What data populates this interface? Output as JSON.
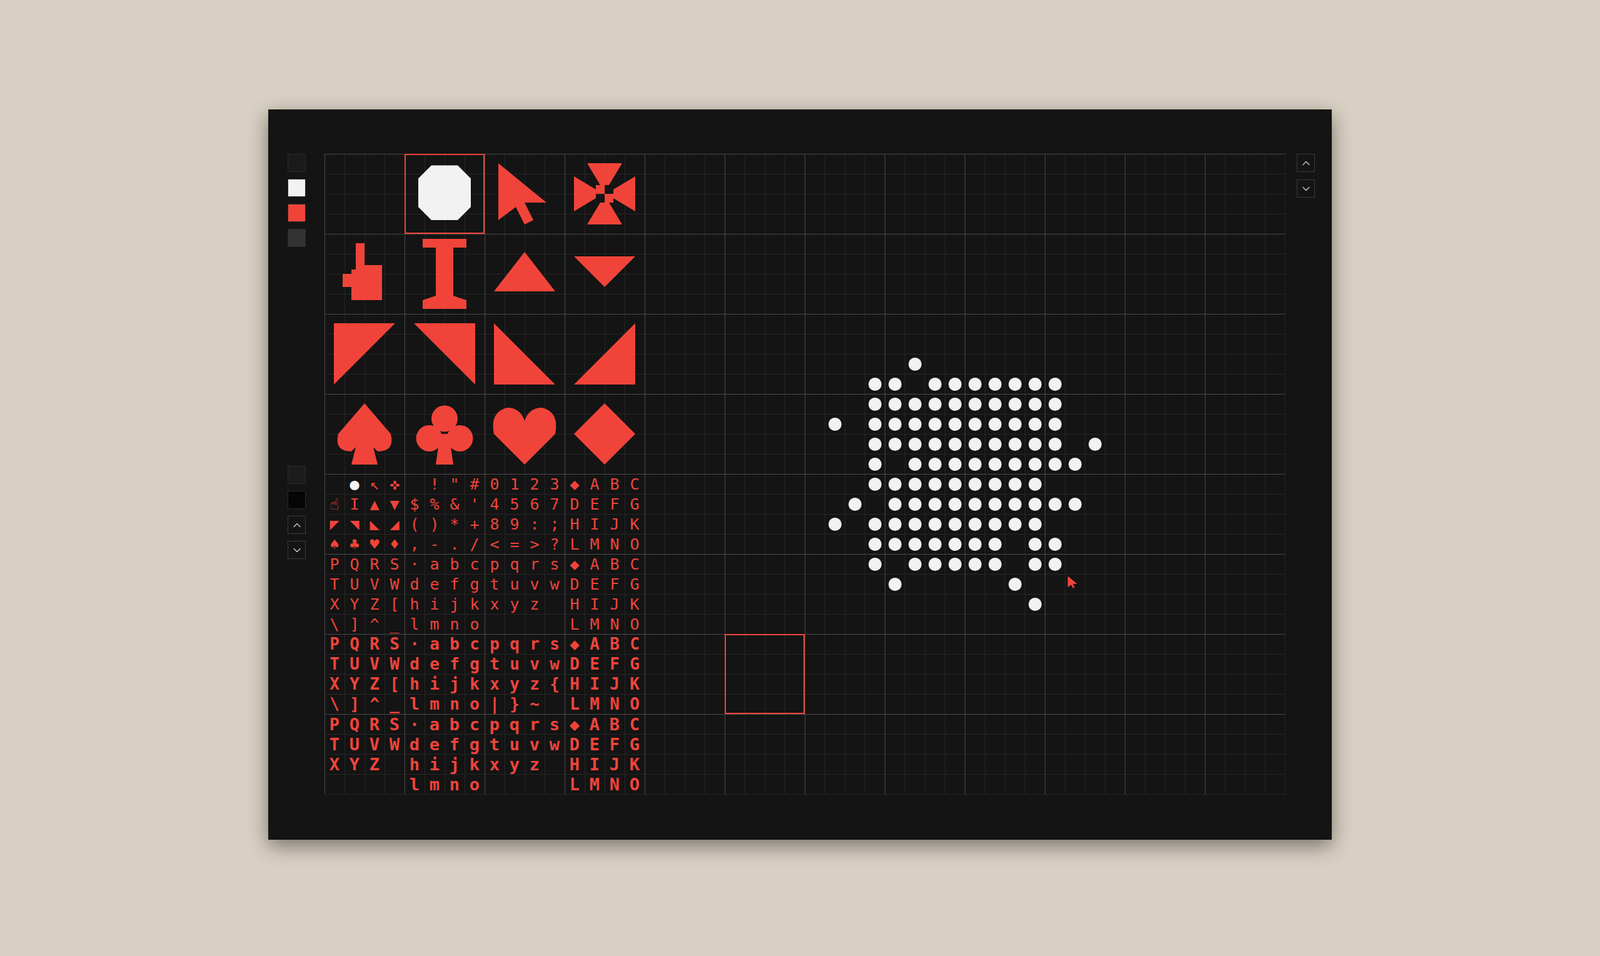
{
  "palette": [
    {
      "color": "#1a1a1a"
    },
    {
      "color": "#f2f2f2"
    },
    {
      "color": "#f0443a"
    },
    {
      "color": "#333333"
    }
  ],
  "palette_secondary": [
    {
      "color": "#1c1c1c"
    },
    {
      "color": "#050505"
    }
  ],
  "tiles": [
    {
      "kind": "empty",
      "color": "#f0443a",
      "selected": false
    },
    {
      "kind": "circle",
      "color": "#f2f2f2",
      "selected": true
    },
    {
      "kind": "pointer",
      "color": "#f0443a",
      "selected": false
    },
    {
      "kind": "cross",
      "color": "#f0443a",
      "selected": false
    },
    {
      "kind": "hand",
      "color": "#f0443a",
      "selected": false
    },
    {
      "kind": "ibeam",
      "color": "#f0443a",
      "selected": false
    },
    {
      "kind": "triangle-up",
      "color": "#f0443a",
      "selected": false
    },
    {
      "kind": "triangle-down",
      "color": "#f0443a",
      "selected": false
    },
    {
      "kind": "corner-top-left",
      "color": "#f0443a",
      "selected": false
    },
    {
      "kind": "corner-top-right",
      "color": "#f0443a",
      "selected": false
    },
    {
      "kind": "corner-bottom-left",
      "color": "#f0443a",
      "selected": false
    },
    {
      "kind": "corner-bottom-right",
      "color": "#f0443a",
      "selected": false
    },
    {
      "kind": "spade",
      "color": "#f0443a",
      "selected": false
    },
    {
      "kind": "club",
      "color": "#f0443a",
      "selected": false
    },
    {
      "kind": "heart",
      "color": "#f0443a",
      "selected": false
    },
    {
      "kind": "diamond",
      "color": "#f0443a",
      "selected": false
    }
  ],
  "glyph_sheet": {
    "selected_glyph": {
      "row": 0,
      "col": 1,
      "color": "#f2f2f2"
    },
    "rows": [
      {
        "weight": "regular",
        "cells": [
          " ",
          "●",
          "↖",
          "✜",
          " ",
          "!",
          "\"",
          "#",
          "0",
          "1",
          "2",
          "3",
          "◆",
          "A",
          "B",
          "C"
        ]
      },
      {
        "weight": "regular",
        "cells": [
          "☝",
          "I",
          "▲",
          "▼",
          "$",
          "%",
          "&",
          "'",
          "4",
          "5",
          "6",
          "7",
          "D",
          "E",
          "F",
          "G"
        ]
      },
      {
        "weight": "regular",
        "cells": [
          "◤",
          "◥",
          "◣",
          "◢",
          "(",
          ")",
          "*",
          "+",
          "8",
          "9",
          ":",
          ";",
          "H",
          "I",
          "J",
          "K"
        ]
      },
      {
        "weight": "regular",
        "cells": [
          "♠",
          "♣",
          "♥",
          "♦",
          ",",
          "-",
          ".",
          "/",
          "<",
          "=",
          ">",
          "?",
          "L",
          "M",
          "N",
          "O"
        ]
      },
      {
        "weight": "regular",
        "cells": [
          "P",
          "Q",
          "R",
          "S",
          "·",
          "a",
          "b",
          "c",
          "p",
          "q",
          "r",
          "s",
          "◆",
          "A",
          "B",
          "C"
        ]
      },
      {
        "weight": "regular",
        "cells": [
          "T",
          "U",
          "V",
          "W",
          "d",
          "e",
          "f",
          "g",
          "t",
          "u",
          "v",
          "w",
          "D",
          "E",
          "F",
          "G"
        ]
      },
      {
        "weight": "regular",
        "cells": [
          "X",
          "Y",
          "Z",
          "[",
          "h",
          "i",
          "j",
          "k",
          "x",
          "y",
          "z",
          " ",
          "H",
          "I",
          "J",
          "K"
        ]
      },
      {
        "weight": "regular",
        "cells": [
          "\\",
          "]",
          "^",
          "_",
          "l",
          "m",
          "n",
          "o",
          " ",
          " ",
          " ",
          " ",
          "L",
          "M",
          "N",
          "O"
        ]
      },
      {
        "weight": "bold",
        "cells": [
          "P",
          "Q",
          "R",
          "S",
          "·",
          "a",
          "b",
          "c",
          "p",
          "q",
          "r",
          "s",
          "◆",
          "A",
          "B",
          "C"
        ]
      },
      {
        "weight": "bold",
        "cells": [
          "T",
          "U",
          "V",
          "W",
          "d",
          "e",
          "f",
          "g",
          "t",
          "u",
          "v",
          "w",
          "D",
          "E",
          "F",
          "G"
        ]
      },
      {
        "weight": "bold",
        "cells": [
          "X",
          "Y",
          "Z",
          "[",
          "h",
          "i",
          "j",
          "k",
          "x",
          "y",
          "z",
          "{",
          "H",
          "I",
          "J",
          "K"
        ]
      },
      {
        "weight": "bold",
        "cells": [
          "\\",
          "]",
          "^",
          "_",
          "l",
          "m",
          "n",
          "o",
          "|",
          "}",
          "~",
          " ",
          "L",
          "M",
          "N",
          "O"
        ]
      },
      {
        "weight": "black",
        "cells": [
          "P",
          "Q",
          "R",
          "S",
          "·",
          "a",
          "b",
          "c",
          "p",
          "q",
          "r",
          "s",
          "◆",
          "A",
          "B",
          "C"
        ]
      },
      {
        "weight": "black",
        "cells": [
          "T",
          "U",
          "V",
          "W",
          "d",
          "e",
          "f",
          "g",
          "t",
          "u",
          "v",
          "w",
          "D",
          "E",
          "F",
          "G"
        ]
      },
      {
        "weight": "black",
        "cells": [
          "X",
          "Y",
          "Z",
          " ",
          "h",
          "i",
          "j",
          "k",
          "x",
          "y",
          "z",
          " ",
          "H",
          "I",
          "J",
          "K"
        ]
      },
      {
        "weight": "black",
        "cells": [
          " ",
          " ",
          " ",
          " ",
          "l",
          "m",
          "n",
          "o",
          " ",
          " ",
          " ",
          " ",
          "L",
          "M",
          "N",
          "O"
        ]
      }
    ]
  },
  "canvas": {
    "pixel_color": "#f2f2f2",
    "cursor": {
      "col": 21,
      "row": 21,
      "color": "#f0443a"
    },
    "selection": {
      "col": 4,
      "row": 24
    },
    "pixels": [
      [
        13,
        10
      ],
      [
        11,
        11
      ],
      [
        12,
        11
      ],
      [
        14,
        11
      ],
      [
        15,
        11
      ],
      [
        16,
        11
      ],
      [
        17,
        11
      ],
      [
        18,
        11
      ],
      [
        19,
        11
      ],
      [
        20,
        11
      ],
      [
        11,
        12
      ],
      [
        12,
        12
      ],
      [
        13,
        12
      ],
      [
        14,
        12
      ],
      [
        15,
        12
      ],
      [
        16,
        12
      ],
      [
        17,
        12
      ],
      [
        18,
        12
      ],
      [
        19,
        12
      ],
      [
        20,
        12
      ],
      [
        9,
        13
      ],
      [
        11,
        13
      ],
      [
        12,
        13
      ],
      [
        13,
        13
      ],
      [
        14,
        13
      ],
      [
        15,
        13
      ],
      [
        16,
        13
      ],
      [
        17,
        13
      ],
      [
        18,
        13
      ],
      [
        19,
        13
      ],
      [
        20,
        13
      ],
      [
        11,
        14
      ],
      [
        12,
        14
      ],
      [
        13,
        14
      ],
      [
        14,
        14
      ],
      [
        15,
        14
      ],
      [
        16,
        14
      ],
      [
        17,
        14
      ],
      [
        18,
        14
      ],
      [
        19,
        14
      ],
      [
        20,
        14
      ],
      [
        22,
        14
      ],
      [
        11,
        15
      ],
      [
        13,
        15
      ],
      [
        14,
        15
      ],
      [
        15,
        15
      ],
      [
        16,
        15
      ],
      [
        17,
        15
      ],
      [
        18,
        15
      ],
      [
        19,
        15
      ],
      [
        20,
        15
      ],
      [
        21,
        15
      ],
      [
        11,
        16
      ],
      [
        12,
        16
      ],
      [
        13,
        16
      ],
      [
        14,
        16
      ],
      [
        15,
        16
      ],
      [
        16,
        16
      ],
      [
        17,
        16
      ],
      [
        18,
        16
      ],
      [
        19,
        16
      ],
      [
        10,
        17
      ],
      [
        12,
        17
      ],
      [
        13,
        17
      ],
      [
        14,
        17
      ],
      [
        15,
        17
      ],
      [
        16,
        17
      ],
      [
        17,
        17
      ],
      [
        18,
        17
      ],
      [
        19,
        17
      ],
      [
        20,
        17
      ],
      [
        21,
        17
      ],
      [
        9,
        18
      ],
      [
        11,
        18
      ],
      [
        12,
        18
      ],
      [
        13,
        18
      ],
      [
        14,
        18
      ],
      [
        15,
        18
      ],
      [
        16,
        18
      ],
      [
        17,
        18
      ],
      [
        18,
        18
      ],
      [
        19,
        18
      ],
      [
        11,
        19
      ],
      [
        12,
        19
      ],
      [
        13,
        19
      ],
      [
        14,
        19
      ],
      [
        15,
        19
      ],
      [
        16,
        19
      ],
      [
        17,
        19
      ],
      [
        19,
        19
      ],
      [
        20,
        19
      ],
      [
        11,
        20
      ],
      [
        13,
        20
      ],
      [
        14,
        20
      ],
      [
        15,
        20
      ],
      [
        16,
        20
      ],
      [
        17,
        20
      ],
      [
        19,
        20
      ],
      [
        20,
        20
      ],
      [
        12,
        21
      ],
      [
        18,
        21
      ],
      [
        19,
        22
      ]
    ]
  }
}
